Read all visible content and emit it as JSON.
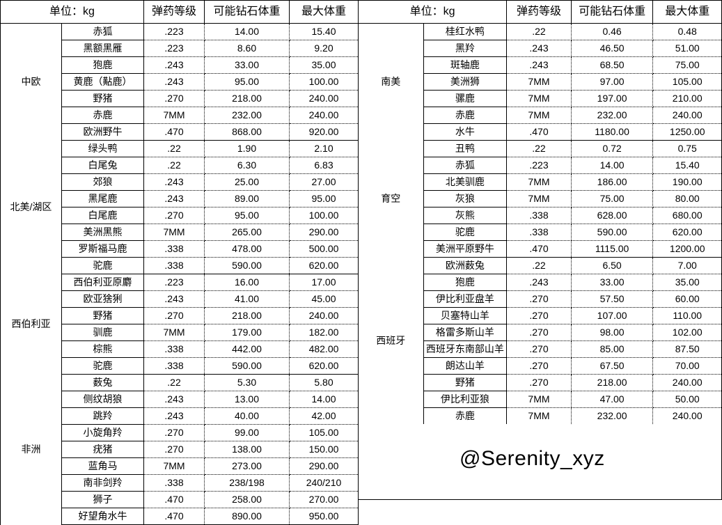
{
  "header": {
    "unit": "单位：kg",
    "ammo": "弹药等级",
    "diamond": "可能钻石体重",
    "maxweight": "最大体重"
  },
  "watermark": "@Serenity_xyz",
  "left_table": {
    "groups": [
      {
        "region": "中欧",
        "rows": [
          {
            "species": "赤狐",
            "ammo": ".223",
            "diamond": "14.00",
            "max": "15.40"
          },
          {
            "species": "黑额黑雁",
            "ammo": ".223",
            "diamond": "8.60",
            "max": "9.20"
          },
          {
            "species": "狍鹿",
            "ammo": ".243",
            "diamond": "33.00",
            "max": "35.00"
          },
          {
            "species": "黄鹿（黇鹿）",
            "ammo": ".243",
            "diamond": "95.00",
            "max": "100.00"
          },
          {
            "species": "野猪",
            "ammo": ".270",
            "diamond": "218.00",
            "max": "240.00"
          },
          {
            "species": "赤鹿",
            "ammo": "7MM",
            "diamond": "232.00",
            "max": "240.00"
          },
          {
            "species": "欧洲野牛",
            "ammo": ".470",
            "diamond": "868.00",
            "max": "920.00"
          }
        ]
      },
      {
        "region": "北美/湖区",
        "rows": [
          {
            "species": "绿头鸭",
            "ammo": ".22",
            "diamond": "1.90",
            "max": "2.10"
          },
          {
            "species": "白尾兔",
            "ammo": ".22",
            "diamond": "6.30",
            "max": "6.83"
          },
          {
            "species": "郊狼",
            "ammo": ".243",
            "diamond": "25.00",
            "max": "27.00"
          },
          {
            "species": "黑尾鹿",
            "ammo": ".243",
            "diamond": "89.00",
            "max": "95.00"
          },
          {
            "species": "白尾鹿",
            "ammo": ".270",
            "diamond": "95.00",
            "max": "100.00"
          },
          {
            "species": "美洲黑熊",
            "ammo": "7MM",
            "diamond": "265.00",
            "max": "290.00"
          },
          {
            "species": "罗斯福马鹿",
            "ammo": ".338",
            "diamond": "478.00",
            "max": "500.00"
          },
          {
            "species": "驼鹿",
            "ammo": ".338",
            "diamond": "590.00",
            "max": "620.00"
          }
        ]
      },
      {
        "region": "西伯利亚",
        "rows": [
          {
            "species": "西伯利亚原麝",
            "ammo": ".223",
            "diamond": "16.00",
            "max": "17.00"
          },
          {
            "species": "欧亚猞猁",
            "ammo": ".243",
            "diamond": "41.00",
            "max": "45.00"
          },
          {
            "species": "野猪",
            "ammo": ".270",
            "diamond": "218.00",
            "max": "240.00"
          },
          {
            "species": "驯鹿",
            "ammo": "7MM",
            "diamond": "179.00",
            "max": "182.00"
          },
          {
            "species": "棕熊",
            "ammo": ".338",
            "diamond": "442.00",
            "max": "482.00"
          },
          {
            "species": "驼鹿",
            "ammo": ".338",
            "diamond": "590.00",
            "max": "620.00"
          }
        ]
      },
      {
        "region": "非洲",
        "rows": [
          {
            "species": "薮兔",
            "ammo": ".22",
            "diamond": "5.30",
            "max": "5.80"
          },
          {
            "species": "侧纹胡狼",
            "ammo": ".243",
            "diamond": "13.00",
            "max": "14.00"
          },
          {
            "species": "跳羚",
            "ammo": ".243",
            "diamond": "40.00",
            "max": "42.00"
          },
          {
            "species": "小旋角羚",
            "ammo": ".270",
            "diamond": "99.00",
            "max": "105.00"
          },
          {
            "species": "疣猪",
            "ammo": ".270",
            "diamond": "138.00",
            "max": "150.00"
          },
          {
            "species": "蓝角马",
            "ammo": "7MM",
            "diamond": "273.00",
            "max": "290.00"
          },
          {
            "species": "南非剑羚",
            "ammo": ".338",
            "diamond": "238/198",
            "max": "240/210"
          },
          {
            "species": "狮子",
            "ammo": ".470",
            "diamond": "258.00",
            "max": "270.00"
          },
          {
            "species": "好望角水牛",
            "ammo": ".470",
            "diamond": "890.00",
            "max": "950.00"
          }
        ]
      }
    ]
  },
  "right_table": {
    "groups": [
      {
        "region": "南美",
        "rows": [
          {
            "species": "桂红水鸭",
            "ammo": ".22",
            "diamond": "0.46",
            "max": "0.48"
          },
          {
            "species": "黑羚",
            "ammo": ".243",
            "diamond": "46.50",
            "max": "51.00"
          },
          {
            "species": "斑轴鹿",
            "ammo": ".243",
            "diamond": "68.50",
            "max": "75.00"
          },
          {
            "species": "美洲狮",
            "ammo": "7MM",
            "diamond": "97.00",
            "max": "105.00"
          },
          {
            "species": "骡鹿",
            "ammo": "7MM",
            "diamond": "197.00",
            "max": "210.00"
          },
          {
            "species": "赤鹿",
            "ammo": "7MM",
            "diamond": "232.00",
            "max": "240.00"
          },
          {
            "species": "水牛",
            "ammo": ".470",
            "diamond": "1180.00",
            "max": "1250.00"
          }
        ]
      },
      {
        "region": "育空",
        "rows": [
          {
            "species": "丑鸭",
            "ammo": ".22",
            "diamond": "0.72",
            "max": "0.75"
          },
          {
            "species": "赤狐",
            "ammo": ".223",
            "diamond": "14.00",
            "max": "15.40"
          },
          {
            "species": "北美驯鹿",
            "ammo": "7MM",
            "diamond": "186.00",
            "max": "190.00"
          },
          {
            "species": "灰狼",
            "ammo": "7MM",
            "diamond": "75.00",
            "max": "80.00"
          },
          {
            "species": "灰熊",
            "ammo": ".338",
            "diamond": "628.00",
            "max": "680.00"
          },
          {
            "species": "驼鹿",
            "ammo": ".338",
            "diamond": "590.00",
            "max": "620.00"
          },
          {
            "species": "美洲平原野牛",
            "ammo": ".470",
            "diamond": "1115.00",
            "max": "1200.00"
          }
        ]
      },
      {
        "region": "西班牙",
        "rows": [
          {
            "species": "欧洲薮兔",
            "ammo": ".22",
            "diamond": "6.50",
            "max": "7.00"
          },
          {
            "species": "狍鹿",
            "ammo": ".243",
            "diamond": "33.00",
            "max": "35.00"
          },
          {
            "species": "伊比利亚盘羊",
            "ammo": ".270",
            "diamond": "57.50",
            "max": "60.00"
          },
          {
            "species": "贝塞特山羊",
            "ammo": ".270",
            "diamond": "107.00",
            "max": "110.00"
          },
          {
            "species": "格雷多斯山羊",
            "ammo": ".270",
            "diamond": "98.00",
            "max": "102.00"
          },
          {
            "species": "西班牙东南部山羊",
            "ammo": ".270",
            "diamond": "85.00",
            "max": "87.50"
          },
          {
            "species": "朗达山羊",
            "ammo": ".270",
            "diamond": "67.50",
            "max": "70.00"
          },
          {
            "species": "野猪",
            "ammo": ".270",
            "diamond": "218.00",
            "max": "240.00"
          },
          {
            "species": "伊比利亚狼",
            "ammo": "7MM",
            "diamond": "47.00",
            "max": "50.00"
          },
          {
            "species": "赤鹿",
            "ammo": "7MM",
            "diamond": "232.00",
            "max": "240.00"
          }
        ]
      }
    ]
  }
}
